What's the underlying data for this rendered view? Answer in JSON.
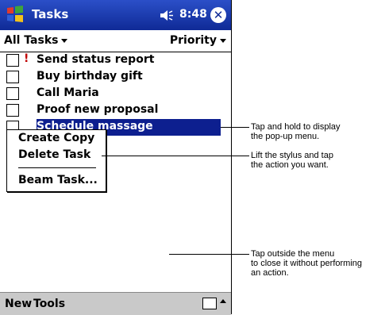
{
  "titlebar": {
    "title": "Tasks",
    "time": "8:48"
  },
  "filterbar": {
    "category": "All Tasks",
    "sort": "Priority"
  },
  "tasks": [
    {
      "label": "Send status report",
      "priority": "!"
    },
    {
      "label": "Buy birthday gift",
      "priority": ""
    },
    {
      "label": "Call Maria",
      "priority": ""
    },
    {
      "label": "Proof new proposal",
      "priority": ""
    },
    {
      "label": "Schedule massage",
      "priority": "!"
    }
  ],
  "popup_menu": {
    "items": [
      "Create Copy",
      "Delete Task",
      "Beam Task..."
    ]
  },
  "bottom_menu": {
    "new": "New",
    "tools": "Tools"
  },
  "callouts": [
    "Tap and hold to display\nthe pop-up menu.",
    "Lift the stylus and tap\nthe action you want.",
    "Tap outside the menu\nto close it without performing\nan action."
  ],
  "colors": {
    "titlebar": "#1f3fb3",
    "selection": "#0d1f8f"
  }
}
